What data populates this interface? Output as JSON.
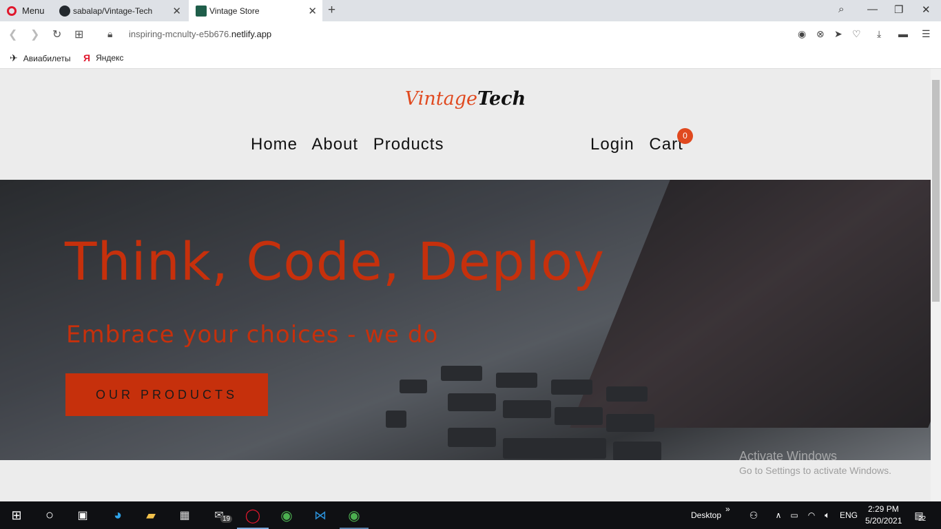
{
  "browser": {
    "menu_label": "Menu",
    "tabs": [
      {
        "title": "sabalap/Vintage-Tech"
      },
      {
        "title": "Vintage Store"
      }
    ],
    "url_prefix": "inspiring-mcnulty-e5b676.",
    "url_domain": "netlify.app",
    "bookmarks": [
      {
        "label": "Авиабилеты"
      },
      {
        "label": "Яндекс"
      }
    ]
  },
  "site": {
    "logo_part1": "Vintage",
    "logo_part2": "Tech",
    "nav": {
      "home": "Home",
      "about": "About",
      "products": "Products",
      "login": "Login",
      "cart": "Cart",
      "cart_count": "0"
    },
    "hero": {
      "title": "Think, Code, Deploy",
      "subtitle": "Embrace your choices - we do",
      "cta": "OUR PRODUCTS"
    }
  },
  "os": {
    "watermark_title": "Activate Windows",
    "watermark_sub": "Go to Settings to activate Windows.",
    "desktop_label": "Desktop",
    "lang": "ENG",
    "time": "2:29 PM",
    "date": "5/20/2021",
    "mail_badge": "19",
    "notif_count": "22"
  }
}
